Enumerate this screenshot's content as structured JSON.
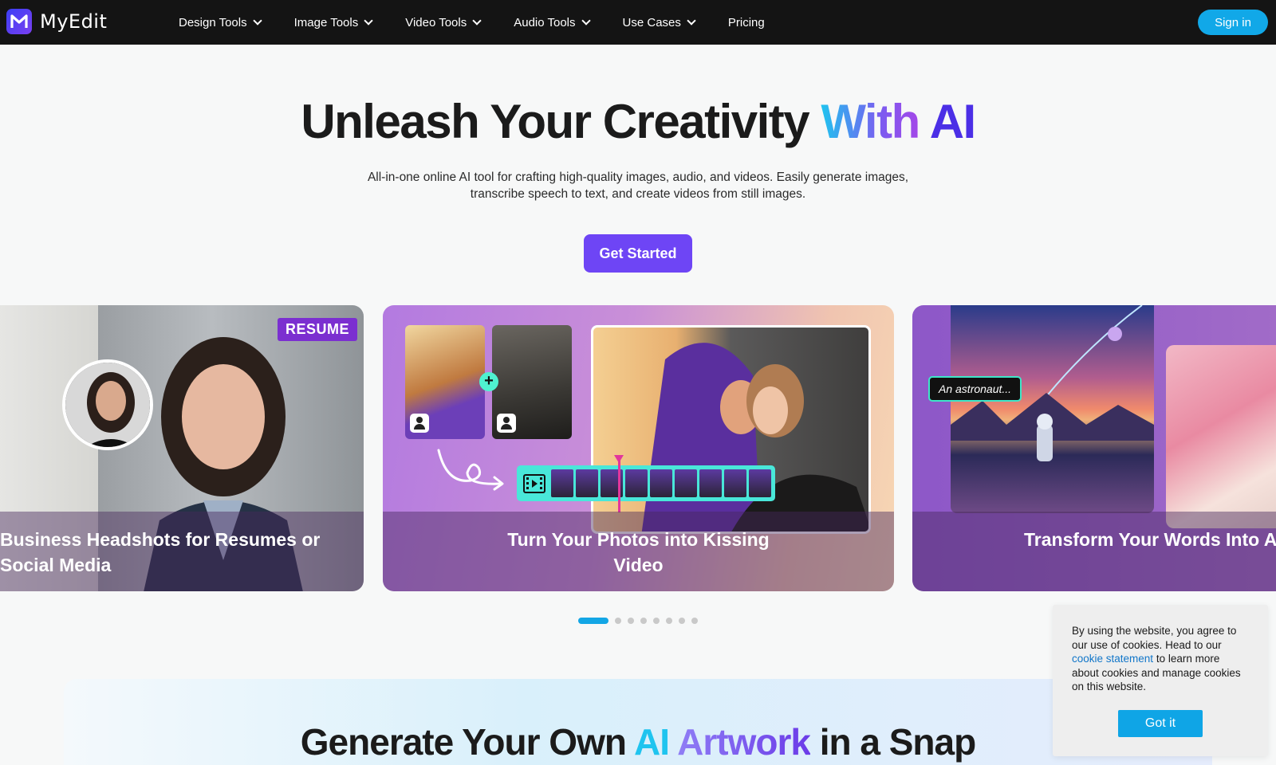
{
  "brand": {
    "name": "MyEdit",
    "accent": "#6e45f5",
    "signin_color": "#11a8e8"
  },
  "nav": {
    "items": [
      {
        "label": "Design Tools",
        "dropdown": true
      },
      {
        "label": "Image Tools",
        "dropdown": true
      },
      {
        "label": "Video Tools",
        "dropdown": true
      },
      {
        "label": "Audio Tools",
        "dropdown": true
      },
      {
        "label": "Use Cases",
        "dropdown": true
      },
      {
        "label": "Pricing",
        "dropdown": false
      }
    ],
    "signin_label": "Sign in"
  },
  "hero": {
    "title_main": "Unleash Your Creativity",
    "title_with": "With",
    "title_ai": "AI",
    "subtitle": "All-in-one online AI tool for crafting high-quality images, audio, and videos. Easily generate images, transcribe speech to text, and create videos from still images.",
    "cta_label": "Get Started"
  },
  "carousel": {
    "cards": [
      {
        "title": "Business Headshots for Resumes or Social Media",
        "badge": "RESUME"
      },
      {
        "title": "Turn Your Photos into Kissing Video"
      },
      {
        "title": "Transform Your Words Into Amazing Art",
        "prompt_tag": "An astronaut..."
      }
    ],
    "active_index": 0,
    "total_slides": 8
  },
  "section": {
    "title_pre": "Generate Your Own",
    "title_ai": "AI",
    "title_artwork": "Artwork",
    "title_post": "in a Snap"
  },
  "cookie": {
    "text_before": "By using the website, you agree to our use of cookies. Head to our",
    "link_text": "cookie statement",
    "text_after": "to learn more about cookies and manage cookies on this website.",
    "button_label": "Got it"
  }
}
